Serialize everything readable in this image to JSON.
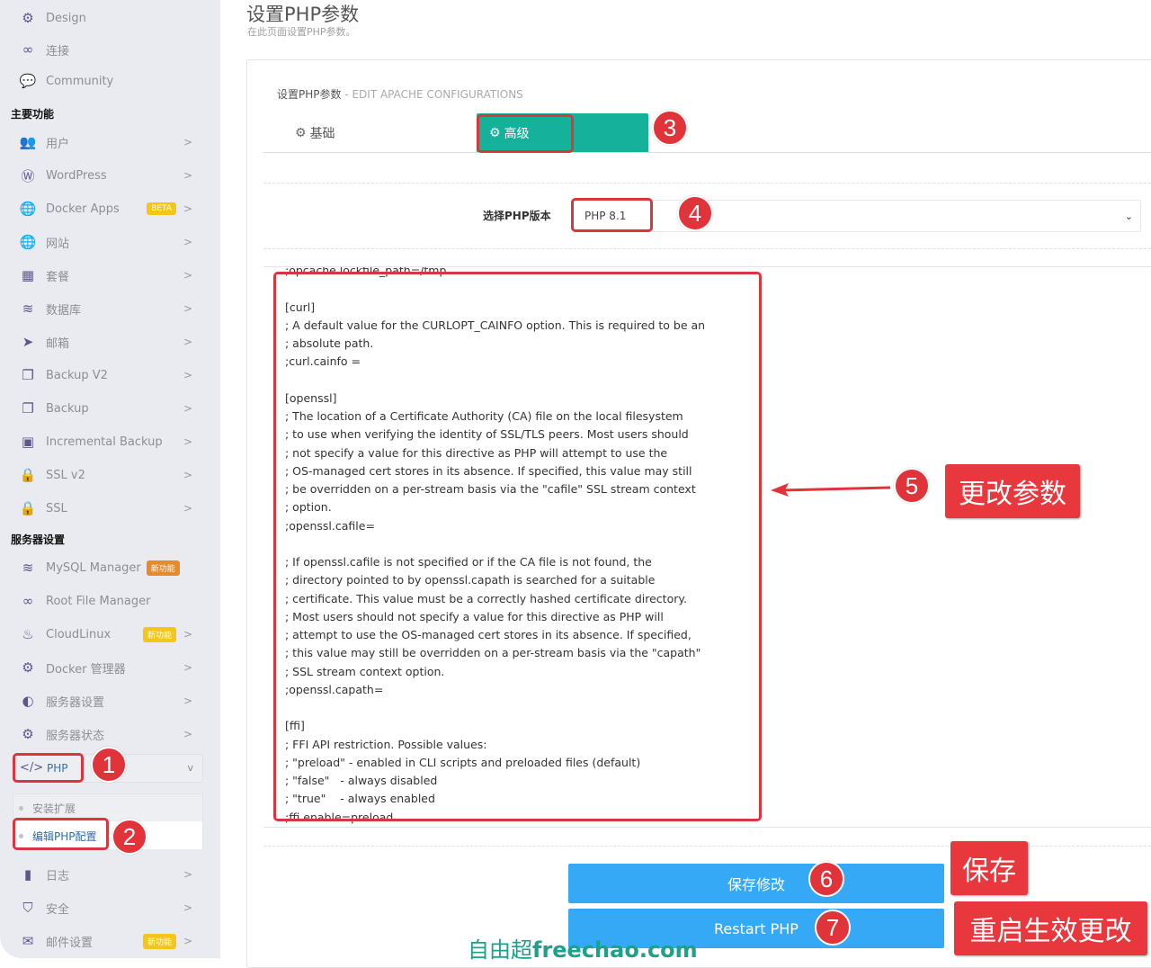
{
  "sidebar": {
    "top_items": [
      {
        "label": "Design",
        "icon": "gear-icon"
      },
      {
        "label": "连接",
        "icon": "link-icon"
      },
      {
        "label": "Community",
        "icon": "comments-icon"
      }
    ],
    "section_main": "主要功能",
    "main_items": [
      {
        "label": "用户",
        "icon": "users-icon",
        "chevron": ">"
      },
      {
        "label": "WordPress",
        "icon": "wordpress-icon",
        "chevron": ">"
      },
      {
        "label": "Docker Apps",
        "icon": "globe-icon",
        "badge": "BETA",
        "chevron": ">"
      },
      {
        "label": "网站",
        "icon": "globe-icon",
        "chevron": ">"
      },
      {
        "label": "套餐",
        "icon": "cubes-icon",
        "chevron": ">"
      },
      {
        "label": "数据库",
        "icon": "database-icon",
        "chevron": ">"
      },
      {
        "label": "邮箱",
        "icon": "paper-plane-icon",
        "chevron": ">"
      },
      {
        "label": "Backup V2",
        "icon": "copy-icon",
        "chevron": ">"
      },
      {
        "label": "Backup",
        "icon": "copy-icon",
        "chevron": ">"
      },
      {
        "label": "Incremental Backup",
        "icon": "floppy-icon",
        "chevron": ">"
      },
      {
        "label": "SSL v2",
        "icon": "lock-icon",
        "chevron": ">"
      },
      {
        "label": "SSL",
        "icon": "lock-icon",
        "chevron": ">"
      }
    ],
    "section_server": "服务器设置",
    "server_items": [
      {
        "label": "MySQL Manager",
        "icon": "database-icon",
        "badge": "新功能"
      },
      {
        "label": "Root File Manager",
        "icon": "link-icon"
      },
      {
        "label": "CloudLinux",
        "icon": "fire-icon",
        "badge": "新功能",
        "chevron": ">"
      },
      {
        "label": "Docker 管理器",
        "icon": "cogs-icon",
        "chevron": ">"
      },
      {
        "label": "服务器设置",
        "icon": "adjust-icon",
        "chevron": ">"
      },
      {
        "label": "服务器状态",
        "icon": "gear-icon",
        "chevron": ">"
      }
    ],
    "php": {
      "label": "PHP",
      "icon": "code-icon",
      "chevron": "v"
    },
    "php_sub": [
      {
        "label": "安装扩展"
      },
      {
        "label": "编辑PHP配置",
        "active": true
      }
    ],
    "bottom_items": [
      {
        "label": "日志",
        "icon": "file-icon",
        "chevron": ">"
      },
      {
        "label": "安全",
        "icon": "shield-icon",
        "chevron": ">"
      },
      {
        "label": "邮件设置",
        "icon": "envelope-icon",
        "badge": "新功能",
        "chevron": ">"
      }
    ]
  },
  "page": {
    "title": "设置PHP参数",
    "subtitle": "在此页面设置PHP参数。"
  },
  "card": {
    "title": "设置PHP参数",
    "title_suffix": " - EDIT APACHE CONFIGURATIONS",
    "tabs": [
      {
        "label": "基础",
        "icon": "gear-icon",
        "active": false
      },
      {
        "label": "高级",
        "icon": "cogs-icon",
        "active": true
      }
    ],
    "version_label": "选择PHP版本",
    "version_selected": "PHP 8.1",
    "editor_lines": [
      ";opcache.lockfile_path=/tmp",
      "",
      "[curl]",
      "; A default value for the CURLOPT_CAINFO option. This is required to be an",
      "; absolute path.",
      ";curl.cainfo =",
      "",
      "[openssl]",
      "; The location of a Certificate Authority (CA) file on the local filesystem",
      "; to use when verifying the identity of SSL/TLS peers. Most users should",
      "; not specify a value for this directive as PHP will attempt to use the",
      "; OS-managed cert stores in its absence. If specified, this value may still",
      "; be overridden on a per-stream basis via the \"cafile\" SSL stream context",
      "; option.",
      ";openssl.cafile=",
      "",
      "; If openssl.cafile is not specified or if the CA file is not found, the",
      "; directory pointed to by openssl.capath is searched for a suitable",
      "; certificate. This value must be a correctly hashed certificate directory.",
      "; Most users should not specify a value for this directive as PHP will",
      "; attempt to use the OS-managed cert stores in its absence. If specified,",
      "; this value may still be overridden on a per-stream basis via the \"capath\"",
      "; SSL stream context option.",
      ";openssl.capath=",
      "",
      "[ffi]",
      "; FFI API restriction. Possible values:",
      "; \"preload\" - enabled in CLI scripts and preloaded files (default)",
      "; \"false\"   - always disabled",
      "; \"true\"    - always enabled",
      ";ffi.enable=preload"
    ],
    "save_button": "保存修改",
    "restart_button": "Restart PHP"
  },
  "annotations": {
    "steps": [
      "1",
      "2",
      "3",
      "4",
      "5",
      "6",
      "7"
    ],
    "callout_edit": "更改参数",
    "callout_save": "保存",
    "callout_restart": "重启生效更改",
    "color_red": "#e8383d",
    "color_teal": "#15b19a",
    "color_blue": "#35a9f5"
  },
  "watermark": {
    "cn": "自由超",
    "en": "freechao.com"
  }
}
